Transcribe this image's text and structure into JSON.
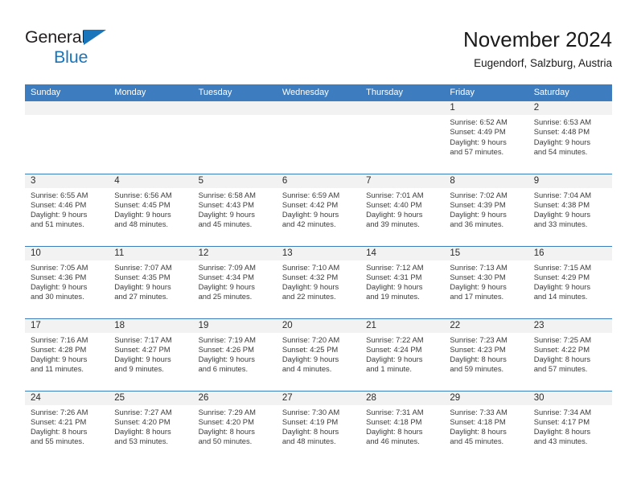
{
  "brand": {
    "name_top": "General",
    "name_bottom": "Blue",
    "accent_color": "#1b75bb"
  },
  "header": {
    "title": "November 2024",
    "subtitle": "Eugendorf, Salzburg, Austria",
    "header_bg_color": "#3d7dbf",
    "daynum_bg_color": "#f2f2f2"
  },
  "calendar": {
    "weekday_headers": [
      "Sunday",
      "Monday",
      "Tuesday",
      "Wednesday",
      "Thursday",
      "Friday",
      "Saturday"
    ],
    "weeks": [
      [
        {
          "day": "",
          "empty": true
        },
        {
          "day": "",
          "empty": true
        },
        {
          "day": "",
          "empty": true
        },
        {
          "day": "",
          "empty": true
        },
        {
          "day": "",
          "empty": true
        },
        {
          "day": "1",
          "sunrise": "Sunrise: 6:52 AM",
          "sunset": "Sunset: 4:49 PM",
          "daylight1": "Daylight: 9 hours",
          "daylight2": "and 57 minutes."
        },
        {
          "day": "2",
          "sunrise": "Sunrise: 6:53 AM",
          "sunset": "Sunset: 4:48 PM",
          "daylight1": "Daylight: 9 hours",
          "daylight2": "and 54 minutes."
        }
      ],
      [
        {
          "day": "3",
          "sunrise": "Sunrise: 6:55 AM",
          "sunset": "Sunset: 4:46 PM",
          "daylight1": "Daylight: 9 hours",
          "daylight2": "and 51 minutes."
        },
        {
          "day": "4",
          "sunrise": "Sunrise: 6:56 AM",
          "sunset": "Sunset: 4:45 PM",
          "daylight1": "Daylight: 9 hours",
          "daylight2": "and 48 minutes."
        },
        {
          "day": "5",
          "sunrise": "Sunrise: 6:58 AM",
          "sunset": "Sunset: 4:43 PM",
          "daylight1": "Daylight: 9 hours",
          "daylight2": "and 45 minutes."
        },
        {
          "day": "6",
          "sunrise": "Sunrise: 6:59 AM",
          "sunset": "Sunset: 4:42 PM",
          "daylight1": "Daylight: 9 hours",
          "daylight2": "and 42 minutes."
        },
        {
          "day": "7",
          "sunrise": "Sunrise: 7:01 AM",
          "sunset": "Sunset: 4:40 PM",
          "daylight1": "Daylight: 9 hours",
          "daylight2": "and 39 minutes."
        },
        {
          "day": "8",
          "sunrise": "Sunrise: 7:02 AM",
          "sunset": "Sunset: 4:39 PM",
          "daylight1": "Daylight: 9 hours",
          "daylight2": "and 36 minutes."
        },
        {
          "day": "9",
          "sunrise": "Sunrise: 7:04 AM",
          "sunset": "Sunset: 4:38 PM",
          "daylight1": "Daylight: 9 hours",
          "daylight2": "and 33 minutes."
        }
      ],
      [
        {
          "day": "10",
          "sunrise": "Sunrise: 7:05 AM",
          "sunset": "Sunset: 4:36 PM",
          "daylight1": "Daylight: 9 hours",
          "daylight2": "and 30 minutes."
        },
        {
          "day": "11",
          "sunrise": "Sunrise: 7:07 AM",
          "sunset": "Sunset: 4:35 PM",
          "daylight1": "Daylight: 9 hours",
          "daylight2": "and 27 minutes."
        },
        {
          "day": "12",
          "sunrise": "Sunrise: 7:09 AM",
          "sunset": "Sunset: 4:34 PM",
          "daylight1": "Daylight: 9 hours",
          "daylight2": "and 25 minutes."
        },
        {
          "day": "13",
          "sunrise": "Sunrise: 7:10 AM",
          "sunset": "Sunset: 4:32 PM",
          "daylight1": "Daylight: 9 hours",
          "daylight2": "and 22 minutes."
        },
        {
          "day": "14",
          "sunrise": "Sunrise: 7:12 AM",
          "sunset": "Sunset: 4:31 PM",
          "daylight1": "Daylight: 9 hours",
          "daylight2": "and 19 minutes."
        },
        {
          "day": "15",
          "sunrise": "Sunrise: 7:13 AM",
          "sunset": "Sunset: 4:30 PM",
          "daylight1": "Daylight: 9 hours",
          "daylight2": "and 17 minutes."
        },
        {
          "day": "16",
          "sunrise": "Sunrise: 7:15 AM",
          "sunset": "Sunset: 4:29 PM",
          "daylight1": "Daylight: 9 hours",
          "daylight2": "and 14 minutes."
        }
      ],
      [
        {
          "day": "17",
          "sunrise": "Sunrise: 7:16 AM",
          "sunset": "Sunset: 4:28 PM",
          "daylight1": "Daylight: 9 hours",
          "daylight2": "and 11 minutes."
        },
        {
          "day": "18",
          "sunrise": "Sunrise: 7:17 AM",
          "sunset": "Sunset: 4:27 PM",
          "daylight1": "Daylight: 9 hours",
          "daylight2": "and 9 minutes."
        },
        {
          "day": "19",
          "sunrise": "Sunrise: 7:19 AM",
          "sunset": "Sunset: 4:26 PM",
          "daylight1": "Daylight: 9 hours",
          "daylight2": "and 6 minutes."
        },
        {
          "day": "20",
          "sunrise": "Sunrise: 7:20 AM",
          "sunset": "Sunset: 4:25 PM",
          "daylight1": "Daylight: 9 hours",
          "daylight2": "and 4 minutes."
        },
        {
          "day": "21",
          "sunrise": "Sunrise: 7:22 AM",
          "sunset": "Sunset: 4:24 PM",
          "daylight1": "Daylight: 9 hours",
          "daylight2": "and 1 minute."
        },
        {
          "day": "22",
          "sunrise": "Sunrise: 7:23 AM",
          "sunset": "Sunset: 4:23 PM",
          "daylight1": "Daylight: 8 hours",
          "daylight2": "and 59 minutes."
        },
        {
          "day": "23",
          "sunrise": "Sunrise: 7:25 AM",
          "sunset": "Sunset: 4:22 PM",
          "daylight1": "Daylight: 8 hours",
          "daylight2": "and 57 minutes."
        }
      ],
      [
        {
          "day": "24",
          "sunrise": "Sunrise: 7:26 AM",
          "sunset": "Sunset: 4:21 PM",
          "daylight1": "Daylight: 8 hours",
          "daylight2": "and 55 minutes."
        },
        {
          "day": "25",
          "sunrise": "Sunrise: 7:27 AM",
          "sunset": "Sunset: 4:20 PM",
          "daylight1": "Daylight: 8 hours",
          "daylight2": "and 53 minutes."
        },
        {
          "day": "26",
          "sunrise": "Sunrise: 7:29 AM",
          "sunset": "Sunset: 4:20 PM",
          "daylight1": "Daylight: 8 hours",
          "daylight2": "and 50 minutes."
        },
        {
          "day": "27",
          "sunrise": "Sunrise: 7:30 AM",
          "sunset": "Sunset: 4:19 PM",
          "daylight1": "Daylight: 8 hours",
          "daylight2": "and 48 minutes."
        },
        {
          "day": "28",
          "sunrise": "Sunrise: 7:31 AM",
          "sunset": "Sunset: 4:18 PM",
          "daylight1": "Daylight: 8 hours",
          "daylight2": "and 46 minutes."
        },
        {
          "day": "29",
          "sunrise": "Sunrise: 7:33 AM",
          "sunset": "Sunset: 4:18 PM",
          "daylight1": "Daylight: 8 hours",
          "daylight2": "and 45 minutes."
        },
        {
          "day": "30",
          "sunrise": "Sunrise: 7:34 AM",
          "sunset": "Sunset: 4:17 PM",
          "daylight1": "Daylight: 8 hours",
          "daylight2": "and 43 minutes."
        }
      ]
    ]
  }
}
